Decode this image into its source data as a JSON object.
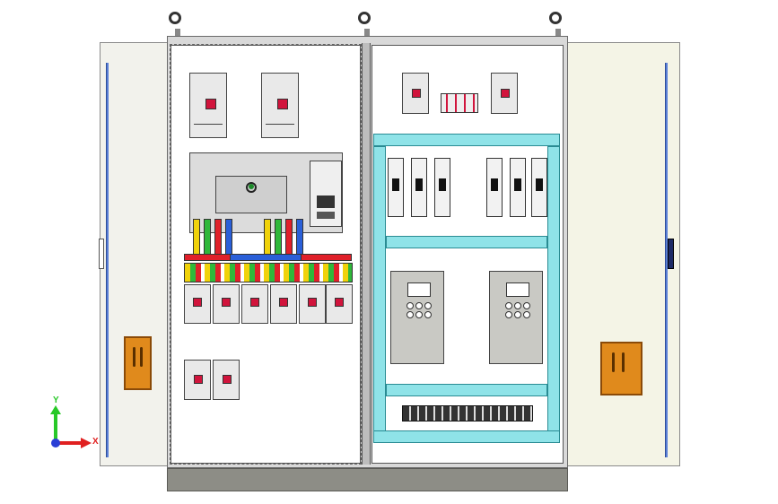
{
  "axes": {
    "y_label": "Y",
    "x_label": "X",
    "y_color": "#28c828",
    "x_color": "#e02020",
    "origin_color": "#2a3fd6"
  },
  "colors": {
    "cabinet_gray": "#d9d9d9",
    "mounting_plate": "#ffffff",
    "cyan_rail": "#8fe3e8",
    "handle_orange": "#e08a1c",
    "door_rod_blue": "#5a7fd6",
    "breaker_accent_red": "#d1143c",
    "base_plinth": "#8d8d86"
  },
  "wire_colors": [
    "#f0d20a",
    "#2fb83a",
    "#e0202a",
    "#2a5fd8"
  ],
  "icons": {
    "lifting_eye": "lifting-eye-icon",
    "handle": "door-handle-icon",
    "axis_triad": "axis-triad-icon"
  }
}
